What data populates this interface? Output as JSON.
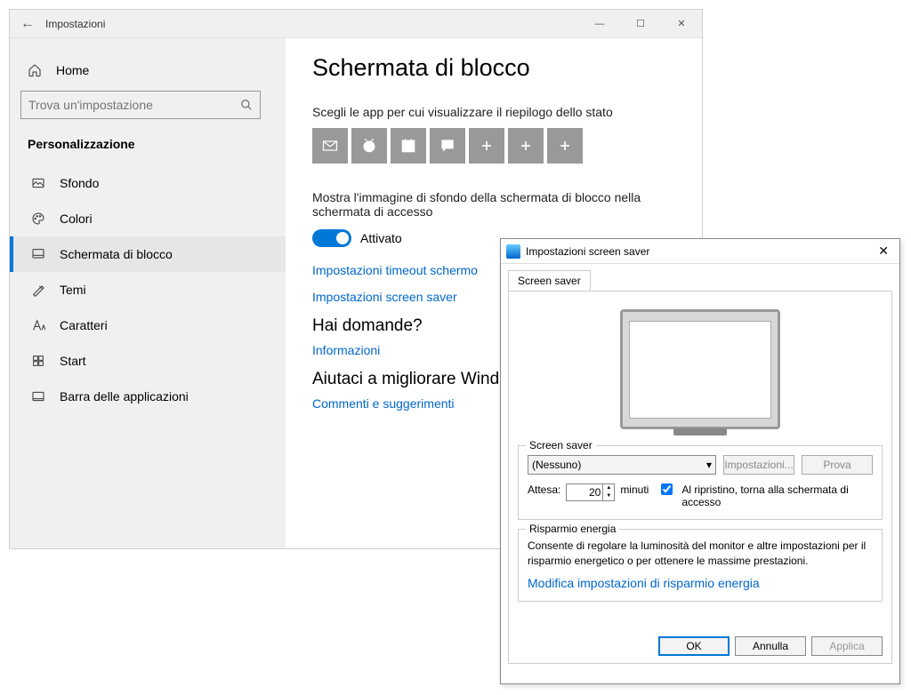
{
  "settings": {
    "window_title": "Impostazioni",
    "home": "Home",
    "search_placeholder": "Trova un'impostazione",
    "category": "Personalizzazione",
    "items": [
      {
        "label": "Sfondo"
      },
      {
        "label": "Colori"
      },
      {
        "label": "Schermata di blocco"
      },
      {
        "label": "Temi"
      },
      {
        "label": "Caratteri"
      },
      {
        "label": "Start"
      },
      {
        "label": "Barra delle applicazioni"
      }
    ],
    "page_title": "Schermata di blocco",
    "apps_label": "Scegli le app per cui visualizzare il riepilogo dello stato",
    "bg_text": "Mostra l'immagine di sfondo della schermata di blocco nella schermata di accesso",
    "toggle_state": "Attivato",
    "link_timeout": "Impostazioni timeout schermo",
    "link_screensaver": "Impostazioni screen saver",
    "q_hdr": "Hai domande?",
    "q_link": "Informazioni",
    "improve_hdr": "Aiutaci a migliorare Wind",
    "improve_link": "Commenti e suggerimenti"
  },
  "dialog": {
    "title": "Impostazioni screen saver",
    "tab": "Screen saver",
    "gb_ss": "Screen saver",
    "select_value": "(Nessuno)",
    "btn_settings": "Impostazioni...",
    "btn_preview": "Prova",
    "wait_label": "Attesa:",
    "wait_value": "20",
    "minutes": "minuti",
    "resume_text": "Al ripristino, torna alla schermata di accesso",
    "gb_power": "Risparmio energia",
    "power_text": "Consente di regolare la luminosità del monitor e altre impostazioni per il risparmio energetico o per ottenere le massime prestazioni.",
    "power_link": "Modifica impostazioni di risparmio energia",
    "ok": "OK",
    "cancel": "Annulla",
    "apply": "Applica"
  }
}
